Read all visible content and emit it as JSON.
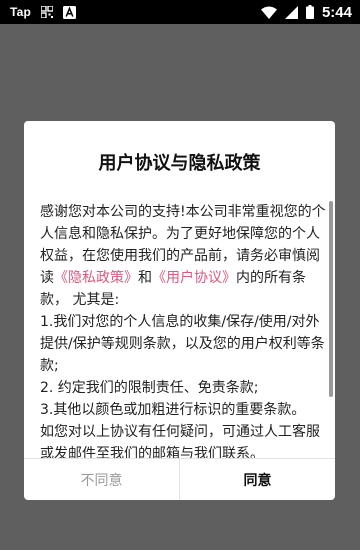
{
  "status_bar": {
    "app_label": "Tap",
    "time": "5:44",
    "icons": [
      "qr-grid-icon",
      "a-box-icon",
      "wifi-icon",
      "cell-signal-icon",
      "battery-icon"
    ]
  },
  "dialog": {
    "title": "用户协议与隐私政策",
    "content": {
      "p1_a": "感谢您对本公司的支持!本公司非常重视您的个人信息和隐私保护。为了更好地保障您的个人权益，在您使用我们的产品前，请务必审慎阅读",
      "privacy_link": "《隐私政策》",
      "p1_b": "和",
      "terms_link": "《用户协议》",
      "p1_c": "内的所有条款， 尤其是:",
      "items": [
        " 1.我们对您的个人信息的收集/保存/使用/对外提供/保护等规则条款，以及您的用户权利等条款;",
        " 2. 约定我们的限制责任、免责条款;",
        " 3.其他以颜色或加粗进行标识的重要条款。"
      ],
      "p_cut": "   如您对以上协议有任何疑问，可通过人工客服或发邮件至我们的邮箱与我们联系。"
    },
    "buttons": {
      "disagree": "不同意",
      "agree": "同意"
    }
  },
  "colors": {
    "overlay": "#5f5f5f",
    "link": "#d95a7c",
    "status_bar": "#000000"
  }
}
